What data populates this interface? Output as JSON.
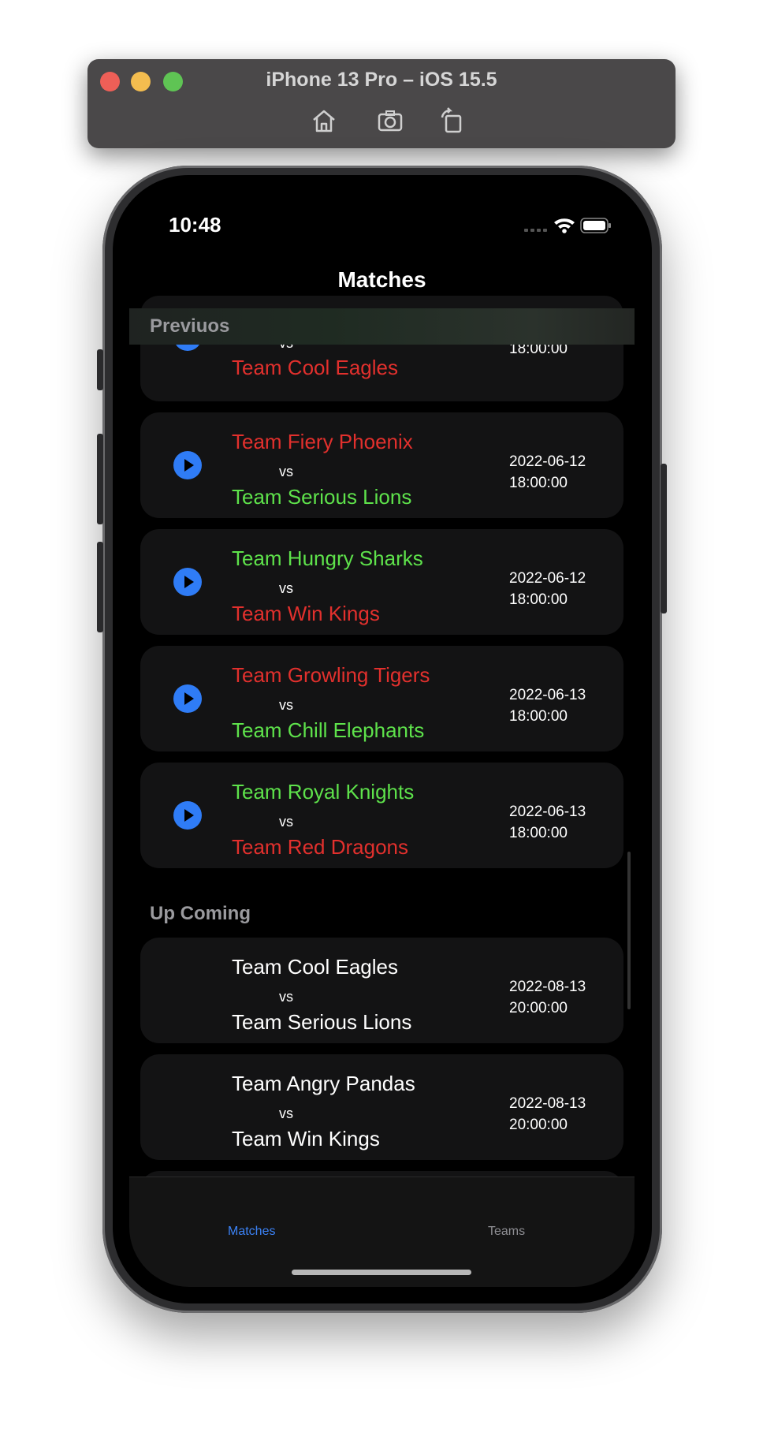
{
  "simulator": {
    "title": "iPhone 13 Pro – iOS 15.5"
  },
  "status": {
    "time": "10:48"
  },
  "nav": {
    "title": "Matches"
  },
  "sections": {
    "previous": {
      "title": "Previuos",
      "partial": {
        "team_bottom": "Team Cool Eagles",
        "vs": "vs",
        "time": "18:00:00"
      },
      "matches": [
        {
          "team_top": "Team Fiery Phoenix",
          "team_bottom": "Team Serious Lions",
          "top_color": "#e2302d",
          "bottom_color": "#5ee24b",
          "vs": "vs",
          "date": "2022-06-12",
          "time": "18:00:00"
        },
        {
          "team_top": "Team Hungry Sharks",
          "team_bottom": "Team Win Kings",
          "top_color": "#5ee24b",
          "bottom_color": "#e2302d",
          "vs": "vs",
          "date": "2022-06-12",
          "time": "18:00:00"
        },
        {
          "team_top": "Team Growling Tigers",
          "team_bottom": "Team Chill Elephants",
          "top_color": "#e2302d",
          "bottom_color": "#5ee24b",
          "vs": "vs",
          "date": "2022-06-13",
          "time": "18:00:00"
        },
        {
          "team_top": "Team Royal Knights",
          "team_bottom": "Team Red Dragons",
          "top_color": "#5ee24b",
          "bottom_color": "#e2302d",
          "vs": "vs",
          "date": "2022-06-13",
          "time": "18:00:00"
        }
      ]
    },
    "upcoming": {
      "title": "Up Coming",
      "matches": [
        {
          "team_top": "Team Cool Eagles",
          "team_bottom": "Team Serious Lions",
          "vs": "vs",
          "date": "2022-08-13",
          "time": "20:00:00"
        },
        {
          "team_top": "Team Angry Pandas",
          "team_bottom": "Team Win Kings",
          "vs": "vs",
          "date": "2022-08-13",
          "time": "20:00:00"
        }
      ]
    }
  },
  "tabs": {
    "matches": "Matches",
    "teams": "Teams"
  },
  "colors": {
    "win": "#5ee24b",
    "loss": "#e2302d",
    "accent": "#2f7cf6"
  },
  "icons": {
    "play": "play-icon",
    "home": "home-icon",
    "screenshot": "camera-icon",
    "rotate": "rotate-icon"
  }
}
